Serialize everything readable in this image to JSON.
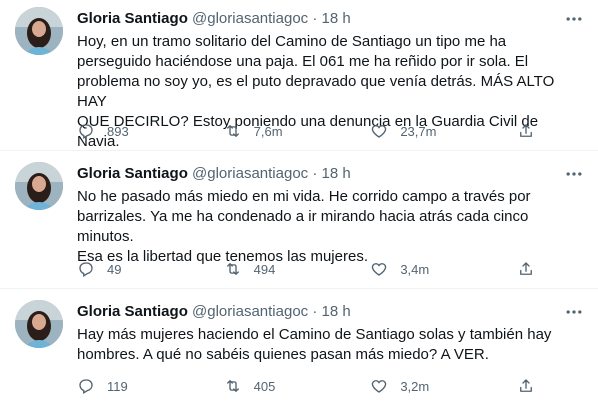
{
  "tweets": [
    {
      "author": {
        "name": "Gloria Santiago",
        "handle": "@gloriasantiagoc"
      },
      "separator": "·",
      "time": "18 h",
      "text": "Hoy, en un tramo solitario del Camino de Santiago un tipo me ha\nperseguido haciéndose una paja. El 061 me ha reñido por ir sola. El\nproblema no soy yo, es el puto depravado que venía detrás. MÁS ALTO HAY\nQUE DECIRLO? Estoy poniendo una denuncia en la Guardia Civil de Navia.",
      "replies": "893",
      "retweets": "7,6m",
      "likes": "23,7m"
    },
    {
      "author": {
        "name": "Gloria Santiago",
        "handle": "@gloriasantiagoc"
      },
      "separator": "·",
      "time": "18 h",
      "text": "No he pasado más miedo en mi vida. He corrido campo a través por\nbarrizales. Ya me ha condenado a ir mirando hacia atrás cada cinco minutos.\nEsa es la libertad que tenemos las mujeres.",
      "replies": "49",
      "retweets": "494",
      "likes": "3,4m"
    },
    {
      "author": {
        "name": "Gloria Santiago",
        "handle": "@gloriasantiagoc"
      },
      "separator": "·",
      "time": "18 h",
      "text": "Hay más mujeres haciendo el Camino de Santiago solas y también hay\nhombres. A qué no sabéis quienes pasan más miedo? A VER.",
      "replies": "119",
      "retweets": "405",
      "likes": "3,2m"
    }
  ],
  "colors": {
    "text_primary": "#0f1419",
    "text_secondary": "#536471",
    "divider": "#eff3f4"
  },
  "icons": {
    "more": "more-horizontal-icon",
    "reply": "reply-icon",
    "retweet": "retweet-icon",
    "like": "heart-icon",
    "share": "share-icon"
  }
}
